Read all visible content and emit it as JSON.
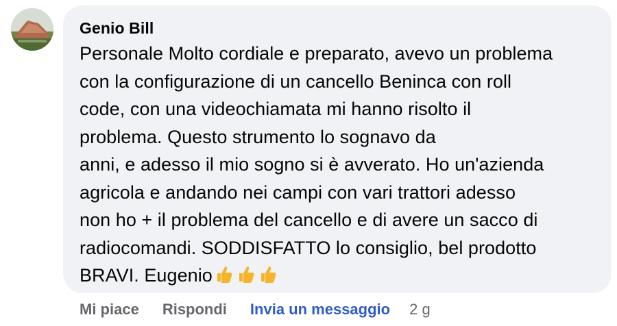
{
  "comment": {
    "author": "Genio Bill",
    "lines": [
      "Personale Molto cordiale e preparato, avevo un problema",
      "con la configurazione di un cancello Beninca con roll",
      "code, con una videochiamata mi hanno risolto il",
      "problema. Questo strumento  lo sognavo da",
      "anni, e adesso il mio sogno si è avverato. Ho un'azienda",
      "agricola e andando nei campi con vari trattori adesso",
      "non ho + il problema del cancello e di avere un sacco di",
      "radiocomandi. SODDISFATTO lo consiglio, bel prodotto",
      "BRAVI. Eugenio"
    ],
    "emoji": [
      "thumbs-up-icon",
      "thumbs-up-icon",
      "thumbs-up-icon"
    ]
  },
  "actions": {
    "like": "Mi piace",
    "reply": "Rispondi",
    "message": "Invia un messaggio",
    "time": "2 g"
  },
  "colors": {
    "bubble": "#f0f2f5",
    "text": "#050505",
    "muted": "#65676b",
    "link": "#2f5cc7",
    "emoji": "#f5b52a"
  }
}
